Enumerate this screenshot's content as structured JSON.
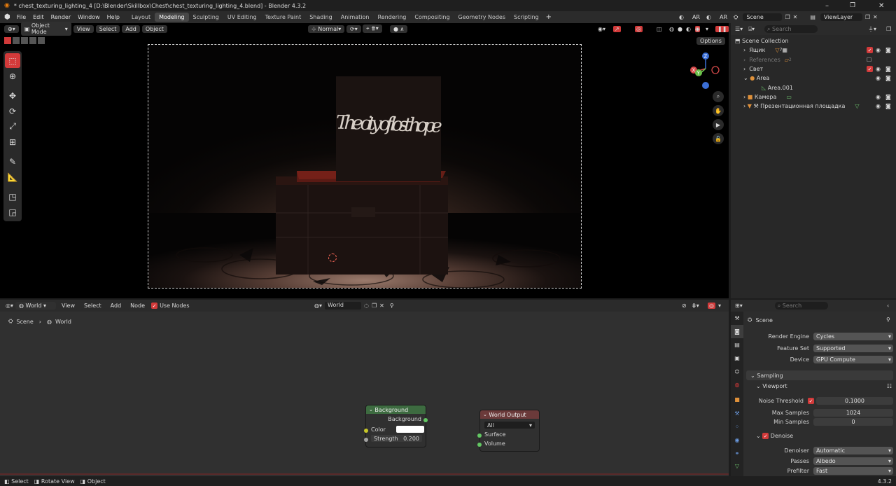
{
  "window": {
    "title": "* chest_texturing_lighting_4 [D:\\Blender\\Skillbox\\Chest\\chest_texturing_lighting_4.blend] - Blender 4.3.2"
  },
  "menu": [
    "File",
    "Edit",
    "Render",
    "Window",
    "Help"
  ],
  "workspaces": [
    "Layout",
    "Modeling",
    "Sculpting",
    "UV Editing",
    "Texture Paint",
    "Shading",
    "Animation",
    "Rendering",
    "Compositing",
    "Geometry Nodes",
    "Scripting"
  ],
  "active_workspace": "Modeling",
  "topright": {
    "ar1": "AR",
    "ar2": "AR",
    "scene": "Scene",
    "view_layer": "ViewLayer"
  },
  "viewport": {
    "mode": "Object Mode",
    "view": "View",
    "select": "Select",
    "add": "Add",
    "object": "Object",
    "orientation": "Normal",
    "options": "Options",
    "gizmo": {
      "z": "Z",
      "y": "Y",
      "x": "X"
    },
    "scene_text": "The city of lost hope"
  },
  "outliner": {
    "search_placeholder": "Search",
    "root": "Scene Collection",
    "items": [
      {
        "label": "Ящик",
        "badge": "7"
      },
      {
        "label": "References",
        "badge": "2"
      },
      {
        "label": "Свет"
      },
      {
        "label": "Area"
      },
      {
        "label": "Area.001"
      },
      {
        "label": "Камера"
      },
      {
        "label": "Презентационная площадка"
      }
    ]
  },
  "node_editor": {
    "type": "World",
    "view": "View",
    "select": "Select",
    "add": "Add",
    "node": "Node",
    "use_nodes": "Use Nodes",
    "world": "World",
    "breadcrumb": [
      "Scene",
      "World"
    ],
    "bg_node": {
      "title": "Background",
      "out": "Background",
      "color_label": "Color",
      "strength_label": "Strength",
      "strength": "0.200"
    },
    "out_node": {
      "title": "World Output",
      "target": "All",
      "surface": "Surface",
      "volume": "Volume"
    }
  },
  "properties": {
    "search_placeholder": "Search",
    "context": "Scene",
    "render_engine": {
      "label": "Render Engine",
      "value": "Cycles"
    },
    "feature_set": {
      "label": "Feature Set",
      "value": "Supported"
    },
    "device": {
      "label": "Device",
      "value": "GPU Compute"
    },
    "sampling": "Sampling",
    "viewport": "Viewport",
    "noise_threshold": {
      "label": "Noise Threshold",
      "value": "0.1000"
    },
    "max_samples": {
      "label": "Max Samples",
      "value": "1024"
    },
    "min_samples": {
      "label": "Min Samples",
      "value": "0"
    },
    "denoise": "Denoise",
    "denoiser": {
      "label": "Denoiser",
      "value": "Automatic"
    },
    "passes": {
      "label": "Passes",
      "value": "Albedo"
    },
    "prefilter": {
      "label": "Prefilter",
      "value": "Fast"
    }
  },
  "status": {
    "select": "Select",
    "rotate": "Rotate View",
    "object": "Object",
    "version": "4.3.2"
  },
  "colors": {
    "accent": "#d23a3a",
    "bg_node_header": "#3d6b40",
    "out_node_header": "#6b3a3a",
    "socket_yellow": "#c7c729",
    "socket_green": "#63c763",
    "socket_grey": "#a1a1a1"
  }
}
